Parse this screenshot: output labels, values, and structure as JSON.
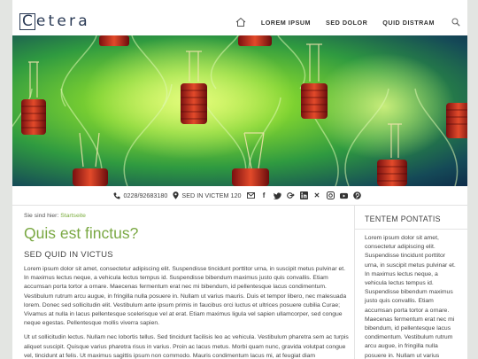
{
  "header": {
    "logo": "Cetera",
    "nav": [
      {
        "label": "LOREM IPSUM"
      },
      {
        "label": "SED DOLOR"
      },
      {
        "label": "QUID DISTRAM"
      }
    ]
  },
  "contact": {
    "phone": "0228/92683180",
    "address": "SED IN VICTEM 120",
    "social_icons": [
      "mail-icon",
      "facebook-icon",
      "twitter-icon",
      "google-plus-icon",
      "linkedin-icon",
      "xing-icon",
      "instagram-icon",
      "youtube-icon",
      "pinterest-icon"
    ]
  },
  "breadcrumb": {
    "prefix": "Sie sind hier:",
    "link": "Startseite"
  },
  "main": {
    "title": "Quis est finctus?",
    "subtitle": "SED QUID IN VICTUS",
    "para1": "Lorem ipsum dolor sit amet, consectetur adipiscing elit. Suspendisse tincidunt porttitor urna, in suscipit metus pulvinar et. In maximus lectus neque, a vehicula lectus tempus id. Suspendisse bibendum maximus justo quis convallis. Etiam accumsan porta tortor a ornare. Maecenas fermentum erat nec mi bibendum, id pellentesque lacus condimentum. Vestibulum rutrum arcu augue, in fringilla nulla posuere in. Nullam ut varius mauris. Duis et tempor libero, nec malesuada lorem. Donec sed sollicitudin elit. Vestibulum ante ipsum primis in faucibus orci luctus et ultrices posuere cubilia Curae; Vivamus at nulla in lacus pellentesque scelerisque vel at erat. Etiam maximus ligula vel sapien ullamcorper, sed congue neque egestas. Pellentesque mollis viverra sapien.",
    "para2": "Ut ut sollicitudin lectus. Nullam nec lobortis tellus. Sed tincidunt facilisis leo ac vehicula. Vestibulum pharetra sem ac turpis aliquet suscipit. Quisque varius pharetra risus in varius. Proin ac lacus metus. Morbi quam nunc, gravida volutpat congue vel, tincidunt at felis. Ut maximus sagittis ipsum non commodo. Mauris condimentum lacus mi, at feugiat diam"
  },
  "sidebar": {
    "title": "TENTEM PONTATIS",
    "text": "Lorem ipsum dolor sit amet, consectetur adipiscing elit. Suspendisse tincidunt porttitor urna, in suscipit metus pulvinar et. In maximus lectus neque, a vehicula lectus tempus id. Suspendisse bibendum maximus justo quis convallis. Etiam accumsan porta tortor a ornare. Maecenas fermentum erat nec mi bibendum, id pellentesque lacus condimentum. Vestibulum rutrum arcu augue, in fringilla nulla posuere in. Nullam ut varius"
  },
  "colors": {
    "accent": "#7aa843",
    "logo": "#2a3a55",
    "page_bg": "#e3e5e2"
  }
}
